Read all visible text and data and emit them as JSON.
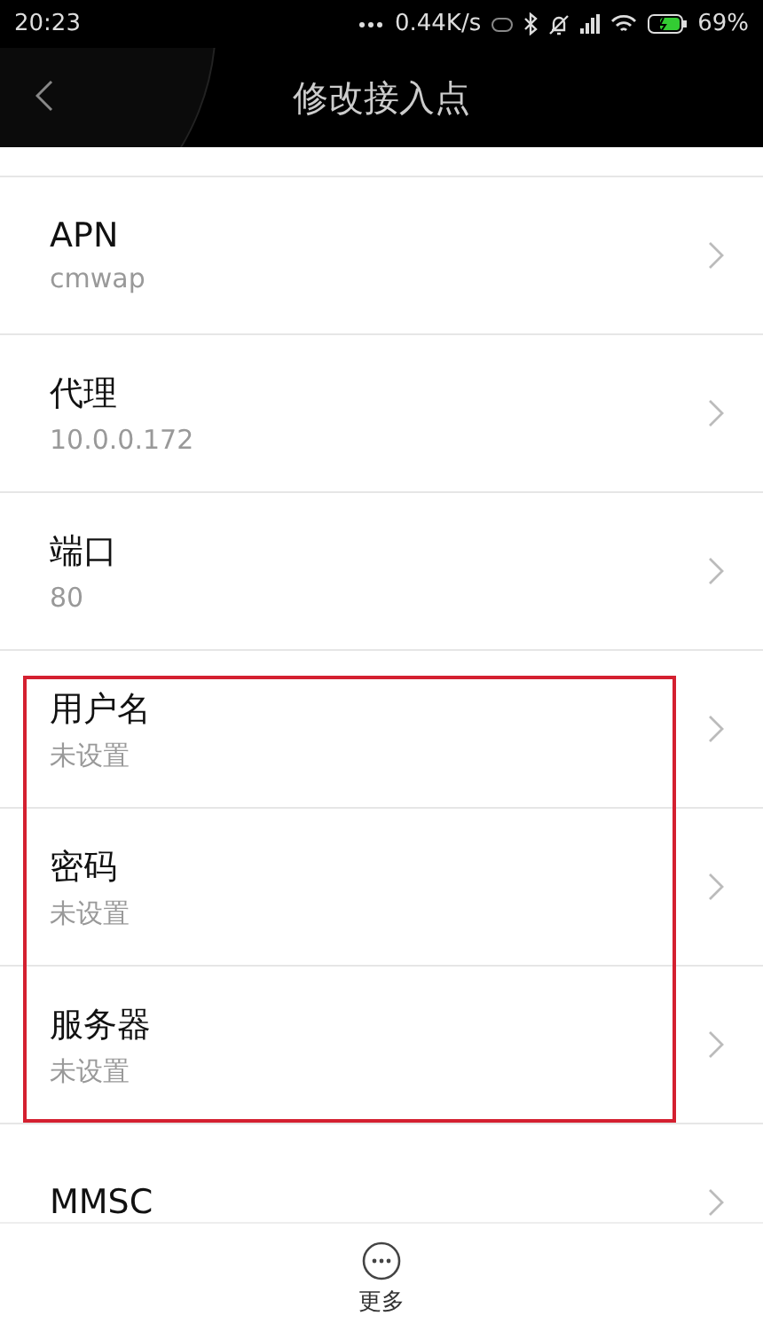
{
  "status_bar": {
    "time": "20:23",
    "speed": "0.44K/s",
    "battery": "69%"
  },
  "header": {
    "title": "修改接入点"
  },
  "rows": [
    {
      "title": "APN",
      "value": "cmwap",
      "highlighted": false
    },
    {
      "title": "代理",
      "value": "10.0.0.172",
      "highlighted": false
    },
    {
      "title": "端口",
      "value": "80",
      "highlighted": false
    },
    {
      "title": "用户名",
      "value": "未设置",
      "highlighted": true
    },
    {
      "title": "密码",
      "value": "未设置",
      "highlighted": true
    },
    {
      "title": "服务器",
      "value": "未设置",
      "highlighted": true
    },
    {
      "title": "MMSC",
      "highlighted": false
    }
  ],
  "bottom_bar": {
    "more_label": "更多"
  }
}
